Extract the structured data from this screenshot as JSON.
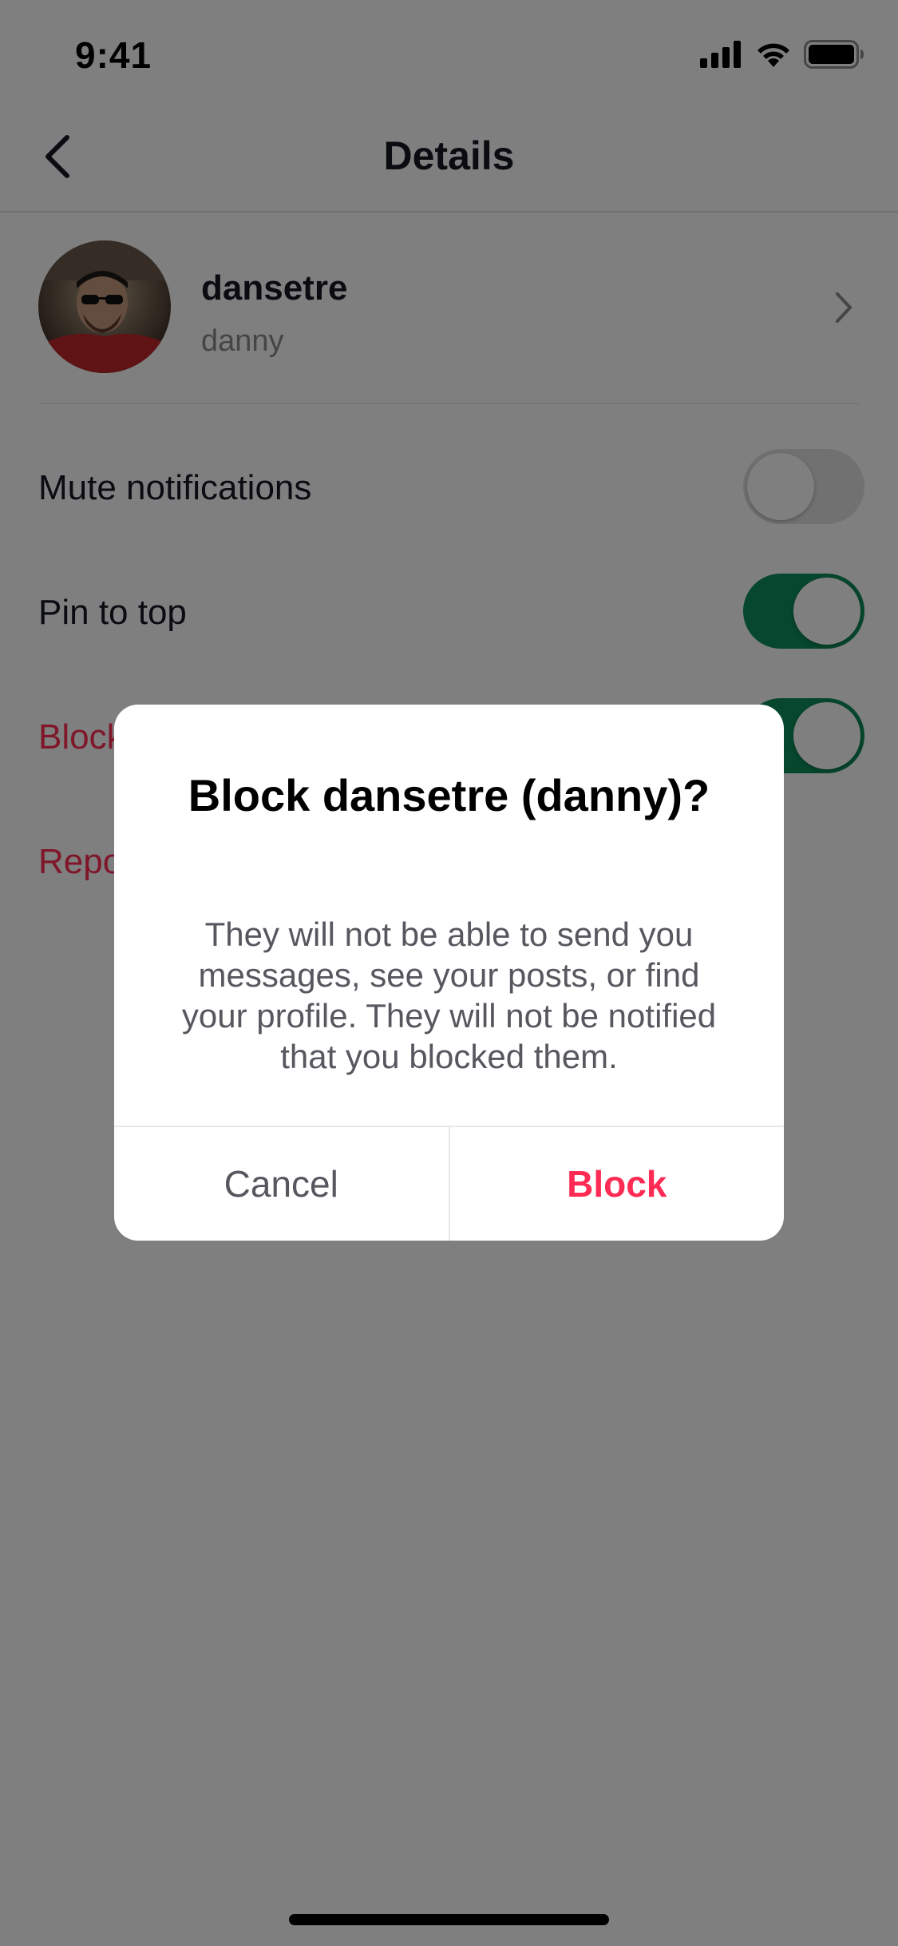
{
  "status_bar": {
    "time": "9:41",
    "icons": [
      "cellular-signal-icon",
      "wifi-icon",
      "battery-icon"
    ]
  },
  "nav": {
    "back_icon": "chevron-left-icon",
    "title": "Details"
  },
  "profile": {
    "username": "dansetre",
    "display_name": "danny",
    "chevron_icon": "chevron-right-icon"
  },
  "settings": {
    "mute": {
      "label": "Mute notifications",
      "enabled": false
    },
    "pin": {
      "label": "Pin to top",
      "enabled": true
    },
    "block": {
      "label": "Block",
      "enabled": true
    },
    "report": {
      "label": "Report"
    }
  },
  "dialog": {
    "title": "Block dansetre (danny)?",
    "message": "They will not be able to send you messages, see your posts, or find your profile. They will not be notified that you blocked them.",
    "cancel_label": "Cancel",
    "confirm_label": "Block"
  },
  "colors": {
    "accent_danger": "#fe2c55",
    "toggle_on": "#0e8f5a",
    "toggle_off": "#e3e3e4",
    "overlay": "rgba(0,0,0,0.5)"
  }
}
